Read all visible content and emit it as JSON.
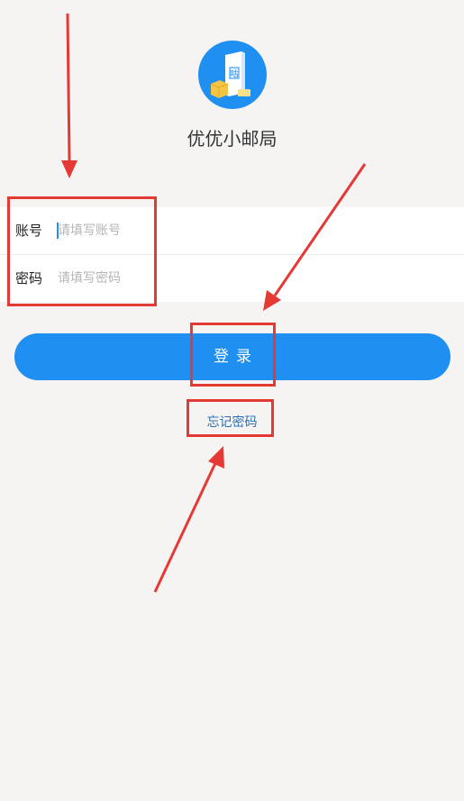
{
  "app": {
    "name": "优优小邮局",
    "logo_icon": "mailbox-package-logo-icon",
    "brand_color": "#1f8ff2"
  },
  "form": {
    "account": {
      "label": "账号",
      "placeholder": "请填写账号",
      "value": ""
    },
    "password": {
      "label": "密码",
      "placeholder": "请填写密码",
      "value": ""
    }
  },
  "actions": {
    "login_label": "登录",
    "forgot_password_label": "忘记密码"
  },
  "annotations": {
    "highlight_color": "#e53935"
  }
}
